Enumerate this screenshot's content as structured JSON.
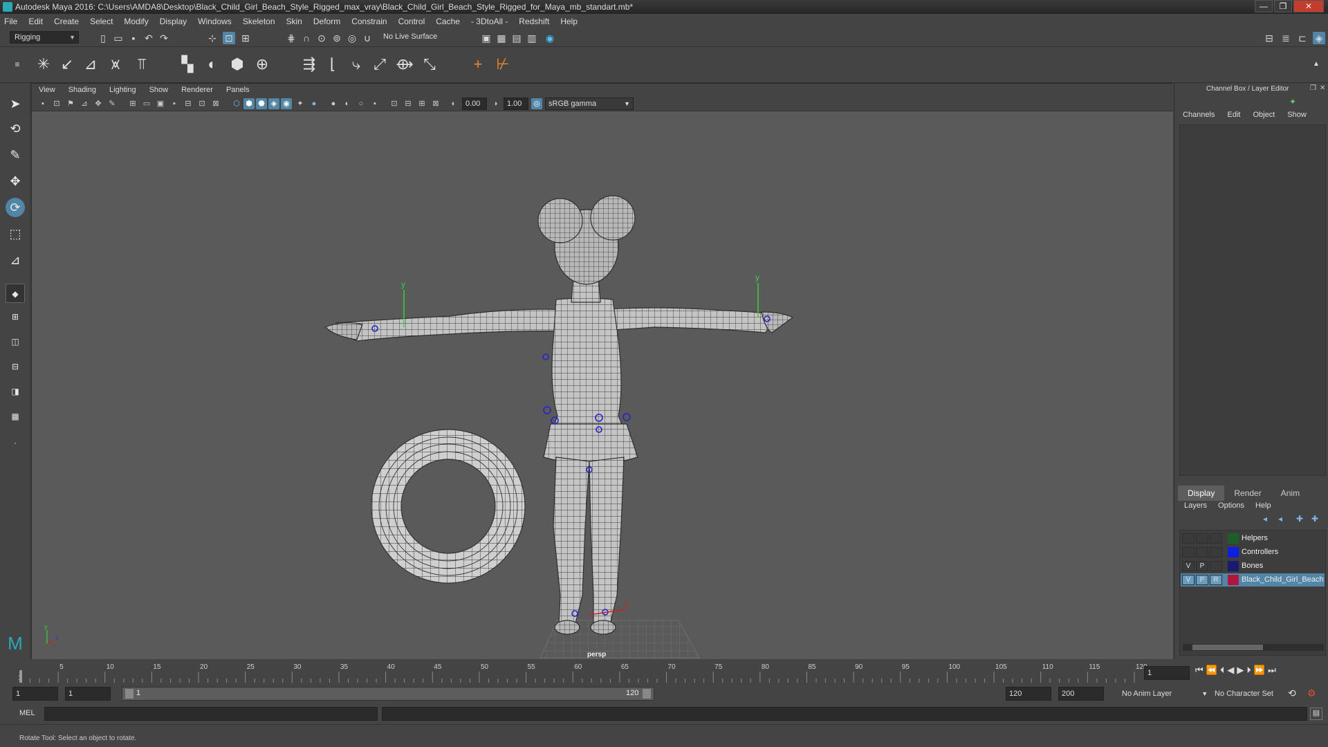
{
  "window": {
    "title": "Autodesk Maya 2016: C:\\Users\\AMDA8\\Desktop\\Black_Child_Girl_Beach_Style_Rigged_max_vray\\Black_Child_Girl_Beach_Style_Rigged_for_Maya_mb_standart.mb*",
    "minimize": "—",
    "maximize": "❐",
    "close": "✕"
  },
  "menus": [
    "File",
    "Edit",
    "Create",
    "Select",
    "Modify",
    "Display",
    "Windows",
    "Skeleton",
    "Skin",
    "Deform",
    "Constrain",
    "Control",
    "Cache",
    "- 3DtoAll -",
    "Redshift",
    "Help"
  ],
  "status_line": {
    "menuset": "Rigging",
    "live_surface": "No Live Surface"
  },
  "viewport": {
    "menus": [
      "View",
      "Shading",
      "Lighting",
      "Show",
      "Renderer",
      "Panels"
    ],
    "exposure": "0.00",
    "gamma": "1.00",
    "color_space": "sRGB gamma",
    "camera_label": "persp",
    "axis_x": "x",
    "axis_y": "y",
    "axis_z": "z"
  },
  "channel_box": {
    "header": "Channel Box / Layer Editor",
    "tabs": [
      "Channels",
      "Edit",
      "Object",
      "Show"
    ]
  },
  "layer_editor": {
    "tabs": [
      "Display",
      "Render",
      "Anim"
    ],
    "active_tab": "Display",
    "menus": [
      "Layers",
      "Options",
      "Help"
    ],
    "layers": [
      {
        "v": "",
        "p": "",
        "r": "",
        "name": "Helpers",
        "color": "#1e5e2b",
        "selected": false
      },
      {
        "v": "",
        "p": "",
        "r": "",
        "name": "Controllers",
        "color": "#0f1fe0",
        "selected": false
      },
      {
        "v": "V",
        "p": "P",
        "r": "",
        "name": "Bones",
        "color": "#1a1a6e",
        "selected": false
      },
      {
        "v": "V",
        "p": "P",
        "r": "R",
        "name": "Black_Child_Girl_Beach",
        "color": "#b0163c",
        "selected": true
      }
    ]
  },
  "timeline": {
    "ticks": [
      "1",
      "5",
      "10",
      "15",
      "20",
      "25",
      "30",
      "35",
      "40",
      "45",
      "50",
      "55",
      "60",
      "65",
      "70",
      "75",
      "80",
      "85",
      "90",
      "95",
      "100",
      "105",
      "110",
      "115",
      "120"
    ],
    "current_frame": "1"
  },
  "range": {
    "start": "1",
    "playback_start": "1",
    "slider_start": "1",
    "slider_end": "120",
    "playback_end": "120",
    "end": "200",
    "anim_layer": "No Anim Layer",
    "character_set": "No Character Set"
  },
  "command_line": {
    "language": "MEL"
  },
  "help_line": "Rotate Tool: Select an object to rotate.",
  "accent": "#5285a6"
}
